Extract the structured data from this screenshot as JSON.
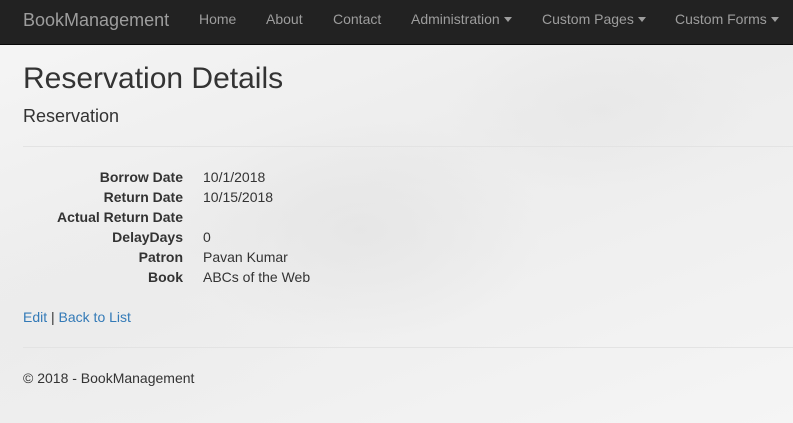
{
  "navbar": {
    "brand": "BookManagement",
    "items": [
      {
        "label": "Home"
      },
      {
        "label": "About"
      },
      {
        "label": "Contact"
      },
      {
        "label": "Administration"
      },
      {
        "label": "Custom Pages"
      },
      {
        "label": "Custom Forms"
      }
    ]
  },
  "page": {
    "title": "Reservation Details",
    "subtitle": "Reservation"
  },
  "details": [
    {
      "term": "Borrow Date",
      "value": "10/1/2018"
    },
    {
      "term": "Return Date",
      "value": "10/15/2018"
    },
    {
      "term": "Actual Return Date",
      "value": ""
    },
    {
      "term": "DelayDays",
      "value": "0"
    },
    {
      "term": "Patron",
      "value": "Pavan Kumar"
    },
    {
      "term": "Book",
      "value": "ABCs of the Web"
    }
  ],
  "actions": {
    "edit": "Edit",
    "separator": "|",
    "back": "Back to List"
  },
  "footer": {
    "text": "© 2018 - BookManagement"
  },
  "colors": {
    "navbar_bg": "#222222",
    "nav_text": "#9d9d9d",
    "link": "#337ab7"
  }
}
